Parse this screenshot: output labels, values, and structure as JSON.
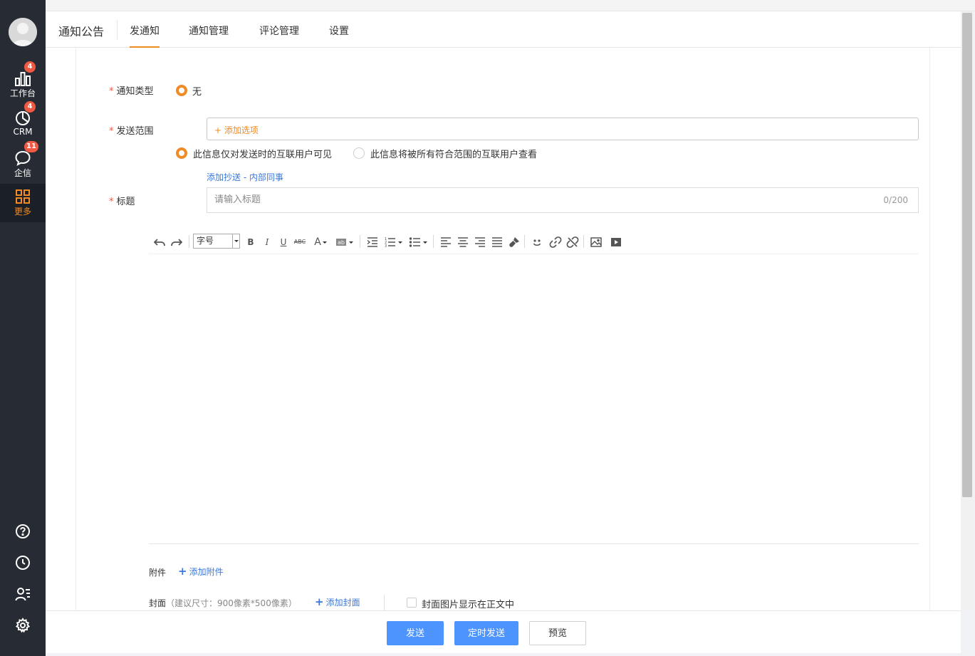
{
  "sidebar": {
    "items": [
      {
        "label": "工作台",
        "badge": "4",
        "icon": "bar-chart-icon"
      },
      {
        "label": "CRM",
        "badge": "4",
        "icon": "pie-chart-icon"
      },
      {
        "label": "企信",
        "badge": "11",
        "icon": "chat-bubble-icon"
      },
      {
        "label": "更多",
        "icon": "grid-icon"
      }
    ],
    "bottom_icons": [
      "help-icon",
      "clock-icon",
      "contacts-icon",
      "gear-icon"
    ]
  },
  "header": {
    "title": "通知公告",
    "tabs": [
      {
        "label": "发通知",
        "active": true
      },
      {
        "label": "通知管理"
      },
      {
        "label": "评论管理"
      },
      {
        "label": "设置"
      }
    ]
  },
  "form": {
    "type_label": "通知类型",
    "type_option": "无",
    "scope_label": "发送范围",
    "scope_add": "+ 添加选项",
    "visibility_option_1": "此信息仅对发送时的互联用户可见",
    "visibility_option_2": "此信息将被所有符合范围的互联用户查看",
    "add_cc": "添加抄送 - 内部同事",
    "title_label": "标题",
    "title_placeholder": "请输入标题",
    "title_count": "0/200",
    "font_size_select": "字号",
    "attachment_label": "附件",
    "add_attachment": "添加附件",
    "cover_label": "封面",
    "cover_hint": "（建议尺寸：900像素*500像素）",
    "add_cover": "添加封面",
    "cover_in_body": "封面图片显示在正文中"
  },
  "footer": {
    "send": "发送",
    "schedule_send": "定时发送",
    "preview": "预览"
  },
  "colors": {
    "accent": "#f08a24",
    "primary_button": "#4d94ff",
    "link": "#3c78d8",
    "sidebar_bg": "#262b34"
  }
}
